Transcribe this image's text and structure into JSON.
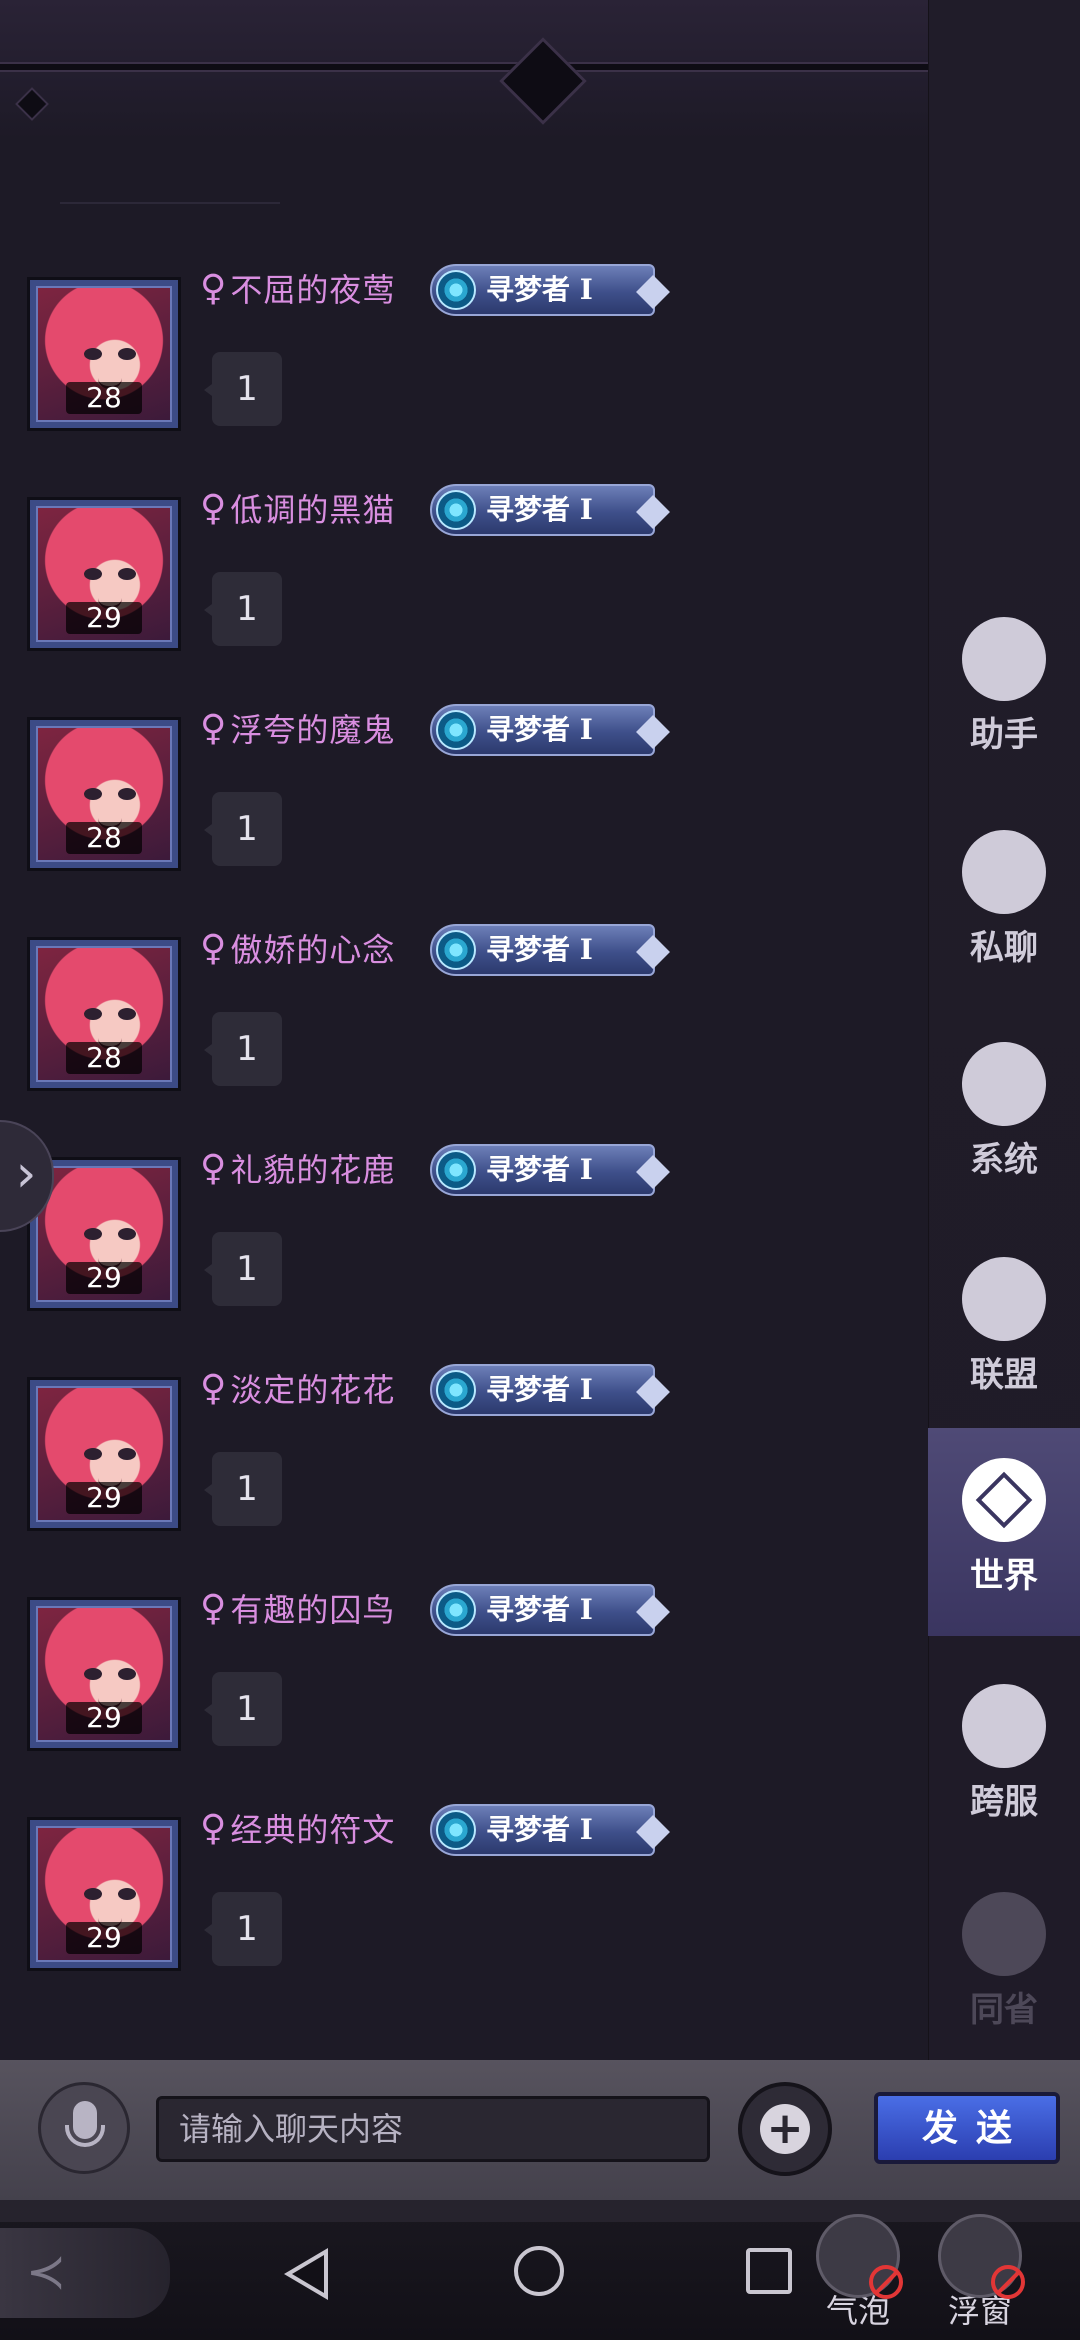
{
  "messages": [
    {
      "gender": "♀",
      "name": "不屈的夜莺",
      "title": "寻梦者 I",
      "level": "28",
      "text": "1"
    },
    {
      "gender": "♀",
      "name": "低调的黑猫",
      "title": "寻梦者 I",
      "level": "29",
      "text": "1"
    },
    {
      "gender": "♀",
      "name": "浮夸的魔鬼",
      "title": "寻梦者 I",
      "level": "28",
      "text": "1"
    },
    {
      "gender": "♀",
      "name": "傲娇的心念",
      "title": "寻梦者 I",
      "level": "28",
      "text": "1"
    },
    {
      "gender": "♀",
      "name": "礼貌的花鹿",
      "title": "寻梦者 I",
      "level": "29",
      "text": "1"
    },
    {
      "gender": "♀",
      "name": "淡定的花花",
      "title": "寻梦者 I",
      "level": "29",
      "text": "1"
    },
    {
      "gender": "♀",
      "name": "有趣的囚鸟",
      "title": "寻梦者 I",
      "level": "29",
      "text": "1"
    },
    {
      "gender": "♀",
      "name": "经典的符文",
      "title": "寻梦者 I",
      "level": "29",
      "text": "1"
    }
  ],
  "side_toggle": {
    "glyph": "›"
  },
  "channels": [
    {
      "label": "助手",
      "icon": "helper-icon",
      "state": "normal"
    },
    {
      "label": "私聊",
      "icon": "private-chat-icon",
      "state": "normal"
    },
    {
      "label": "系统",
      "icon": "megaphone-icon",
      "state": "normal"
    },
    {
      "label": "联盟",
      "icon": "banner-icon",
      "state": "normal"
    },
    {
      "label": "世界",
      "icon": "compass-icon",
      "state": "active"
    },
    {
      "label": "跨服",
      "icon": "planet-icon",
      "state": "normal"
    },
    {
      "label": "同省",
      "icon": "location-pin-icon",
      "state": "disabled"
    }
  ],
  "input": {
    "placeholder": "请输入聊天内容",
    "plus": "+",
    "send_label": "发送"
  },
  "floating_tools": [
    {
      "label": "气泡",
      "icon": "bubble-icon"
    },
    {
      "label": "浮窗",
      "icon": "float-window-icon"
    }
  ],
  "colors": {
    "background": "#1d1a26",
    "name": "#d98ee0",
    "active_channel": "#4f4a76",
    "send_button": "#3450cc"
  }
}
